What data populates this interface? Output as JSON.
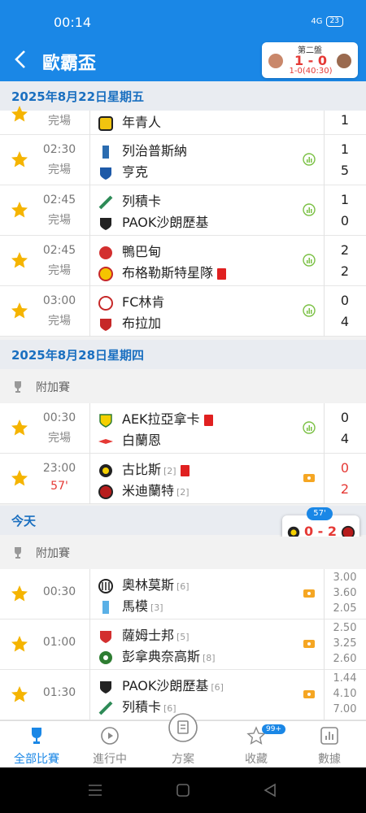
{
  "status_bar": {
    "time": "00:14",
    "signal": "4G",
    "battery": "23"
  },
  "app_bar": {
    "title": "歐霸盃"
  },
  "live_card": {
    "half": "第二盤",
    "score": "1 - 0",
    "sub": "1-0(40:30)"
  },
  "dates": {
    "d1": "2025年8月22日星期五",
    "d2": "2025年8月28日星期四",
    "today": "今天"
  },
  "leagues": {
    "playoff_1": "附加賽",
    "playoff_2": "附加賽"
  },
  "matches": [
    {
      "time": "",
      "status": "完場",
      "home": "年青人",
      "away": "",
      "score_home": "",
      "score_away": "1"
    },
    {
      "time": "02:30",
      "status": "完場",
      "home": "列治普斯納",
      "away": "亨克",
      "score_home": "1",
      "score_away": "5"
    },
    {
      "time": "02:45",
      "status": "完場",
      "home": "列積卡",
      "away": "PAOK沙朗歷基",
      "score_home": "1",
      "score_away": "0"
    },
    {
      "time": "02:45",
      "status": "完場",
      "home": "鴨巴甸",
      "away": "布格勒斯特星隊",
      "score_home": "2",
      "score_away": "2"
    },
    {
      "time": "03:00",
      "status": "完場",
      "home": "FC林肯",
      "away": "布拉加",
      "score_home": "0",
      "score_away": "4"
    },
    {
      "time": "00:30",
      "status": "完場",
      "home": "AEK拉亞拿卡",
      "away": "白蘭恩",
      "score_home": "0",
      "score_away": "4"
    },
    {
      "time": "23:00",
      "status": "57'",
      "home": "古比斯",
      "home_rank": "[2]",
      "away": "米迪蘭特",
      "away_rank": "[2]",
      "score_home": "0",
      "score_away": "2"
    },
    {
      "time": "00:30",
      "home": "奧林莫斯",
      "home_rank": "[6]",
      "away": "馬模",
      "away_rank": "[3]",
      "odds": [
        "3.00",
        "3.60",
        "2.05"
      ]
    },
    {
      "time": "01:00",
      "home": "薩姆士邦",
      "home_rank": "[5]",
      "away": "彭拿典奈高斯",
      "away_rank": "[8]",
      "odds": [
        "2.50",
        "3.25",
        "2.60"
      ]
    },
    {
      "time": "01:30",
      "home": "PAOK沙朗歷基",
      "home_rank": "[6]",
      "away": "列積卡",
      "away_rank": "[6]",
      "odds": [
        "1.44",
        "4.10",
        "7.00"
      ]
    }
  ],
  "float_score": {
    "minute": "57'",
    "score": "0 - 2"
  },
  "tabs": [
    {
      "label": "全部比賽",
      "icon": "trophy-icon"
    },
    {
      "label": "進行中",
      "icon": "play-icon"
    },
    {
      "label": "方案",
      "icon": "plan-icon"
    },
    {
      "label": "收藏",
      "icon": "star-icon",
      "badge": "99+"
    },
    {
      "label": "數據",
      "icon": "chart-icon"
    }
  ],
  "colors": {
    "primary": "#1a87e6",
    "live": "#e53935",
    "star": "#f5b400"
  }
}
